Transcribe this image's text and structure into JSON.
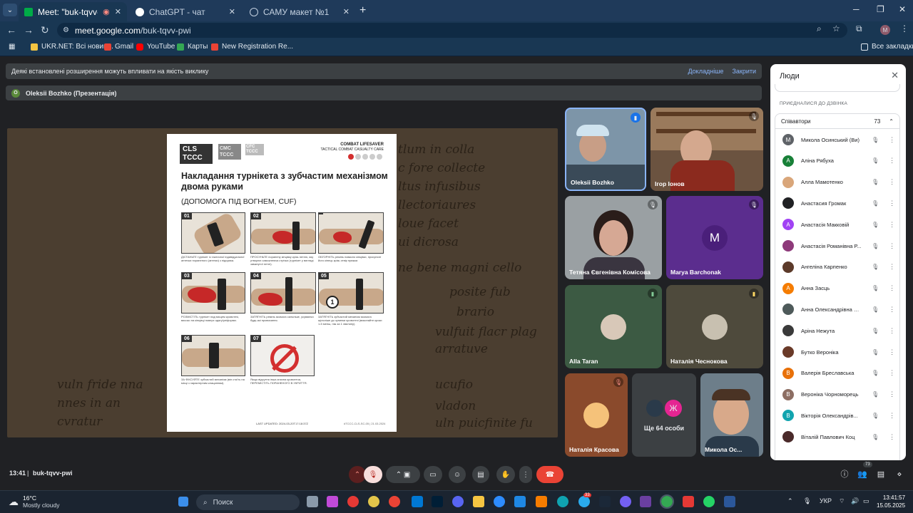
{
  "browser": {
    "tabs": [
      {
        "title": "Meet: \"buk-tqvv-pwi\"",
        "color": "#1a73e8"
      },
      {
        "title": "ChatGPT - чат",
        "color": "#ffffff"
      },
      {
        "title": "САМУ макет №1",
        "color": "#5f6368"
      }
    ],
    "url_host": "meet.google.com",
    "url_path": "/buk-tqvv-pwi",
    "profile_initial": "M"
  },
  "bookmarks": {
    "items": [
      "UKR.NET: Всі новин...",
      "Gmail",
      "YouTube",
      "Карты",
      "New Registration Re..."
    ],
    "all_label": "Все закладки"
  },
  "meet": {
    "banner": {
      "text": "Деякі встановлені розширення можуть впливати на якість виклику",
      "details": "Докладніше",
      "close": "Закрити"
    },
    "presenter": {
      "initial": "O",
      "name": "Oleksii Bozhko (Презентація)"
    },
    "slide": {
      "logo_cls": "CLS",
      "logo_tccc": "TCCC",
      "logo_cmc": "CMC",
      "logo_tccc2": "TCCC",
      "logo_cfc": "CFC",
      "logo_tccc3": "TCCC",
      "header_top": "COMBAT LIFESAVER",
      "header_sub": "TACTICAL COMBAT CASUALTY CARE",
      "title": "Накладання турнікета з зубчастим механізмом двома руками",
      "subtitle": "(ДОПОМОГА ПІД ВОГНЕМ, CUF)",
      "steps": [
        {
          "num": "01",
          "text": "ДІСТАНЬТЕ турнікет із тактичної індивідуальної аптечки пораненого (аптеки) з підсумка."
        },
        {
          "num": "02",
          "text": "ПРОСУНЬТЕ поранену кінцівку крізь петлю, яку утворює самоклеюча стрічка (турнікет у вигляді замкнутої петлі)."
        },
        {
          "num": "",
          "text": "ОБГОРНІТЬ ремінь навколо кінцівки, просуньте його кінець крізь отвір пряжки."
        },
        {
          "num": "03",
          "text": "РОЗМІСТІТЬ турнікет над місцем кровотечі, високо на кінцівці поверх одягу/уніформи."
        },
        {
          "num": "04",
          "text": "ЗАТЯГНІТЬ ремінь якомога сильніше, усуваючи будь-які провисання."
        },
        {
          "num": "05",
          "text": "ЗАТЯГНІТЬ зубчастий механізм якомога щільніше до зупинки кровотечі (виконайте кроки 1-5 менш, ніж за 1 хвилину)."
        },
        {
          "num": "06",
          "text": "ЗА ФІКСУЙТЕ зубчастий механізм (він стоїть на місці з характерним клацанням)."
        },
        {
          "num": "07",
          "text": "Якщо відсутня інша значна кровотеча, ПЕРЕМІСТІТЬ ПОРАНЕНОГО В УКРИТТЯ."
        }
      ],
      "footer_left": "LAST UPDATED: 2024-03-20T17:18:37Z",
      "footer_right": "#TCCC-CLS-SC-05 | 21.03.2024"
    },
    "tiles": [
      {
        "name": "Oleksii Bozhko",
        "bg": "#6f8aa0"
      },
      {
        "name": "Ігор Іонов",
        "bg": "#8a6e52"
      },
      {
        "name": "Тетяна Євгенівна Комісова",
        "bg": "#9aa0a3"
      },
      {
        "name": "Marya Barchonak",
        "bg": "#5b2d8e",
        "initial": "M",
        "avatar_color": "#4a1f7a"
      },
      {
        "name": "Alla Taran",
        "bg": "#3c5a43"
      },
      {
        "name": "Наталія Чеснокова",
        "bg": "#4e4a3c"
      },
      {
        "name": "Наталія Красова",
        "bg": "#8a4a2c"
      },
      {
        "name": "Ще 64 особи",
        "bg": "#3c4043",
        "initial": "Ж",
        "avatar_color": "#e52592"
      },
      {
        "name": "Микола Ос...",
        "bg": "#6d7e8a"
      }
    ],
    "people": {
      "title": "Люди",
      "section": "ПРИЄДНАЛИСЯ ДО ДЗВІНКА",
      "group_label": "Співавтори",
      "group_count": "73",
      "participants": [
        {
          "name": "Микола Осинський (Ви)",
          "initial": "M",
          "color": "#5f6368"
        },
        {
          "name": "Аліна Рябуха",
          "initial": "A",
          "color": "#188038"
        },
        {
          "name": "Алла Мамотенко",
          "initial": "",
          "color": "#d9a67a"
        },
        {
          "name": "Анастасия Громак",
          "initial": "",
          "color": "#202124"
        },
        {
          "name": "Анастасія Макковій",
          "initial": "A",
          "color": "#a142f4"
        },
        {
          "name": "Анастасія Романівна Р...",
          "initial": "",
          "color": "#8e3a7a"
        },
        {
          "name": "Ангеліна Карпенко",
          "initial": "",
          "color": "#5c3a2a"
        },
        {
          "name": "Анна Засць",
          "initial": "A",
          "color": "#f57c00"
        },
        {
          "name": "Анна Олександрівна С...",
          "initial": "",
          "color": "#4e5a5a"
        },
        {
          "name": "Аріна Нежута",
          "initial": "",
          "color": "#3a3a3a"
        },
        {
          "name": "Бутко Вероніка",
          "initial": "",
          "color": "#6a3a28"
        },
        {
          "name": "Валерія Бреславська",
          "initial": "B",
          "color": "#e8710a"
        },
        {
          "name": "Вероніка Чорноморець",
          "initial": "B",
          "color": "#8d6e63"
        },
        {
          "name": "Вікторія Олександрів...",
          "initial": "B",
          "color": "#12a4af"
        },
        {
          "name": "Віталій Павлович Коц",
          "initial": "",
          "color": "#4a2a2a"
        }
      ]
    },
    "bottom": {
      "time": "13:41",
      "sep": "|",
      "code": "buk-tqvv-pwi",
      "people_badge": "73"
    }
  },
  "taskbar": {
    "weather_temp": "16°C",
    "weather_text": "Mostly cloudy",
    "search_placeholder": "Поиск",
    "lang": "УКР",
    "time": "13:41:57",
    "date": "15.05.2025",
    "steam_badge": "33"
  }
}
